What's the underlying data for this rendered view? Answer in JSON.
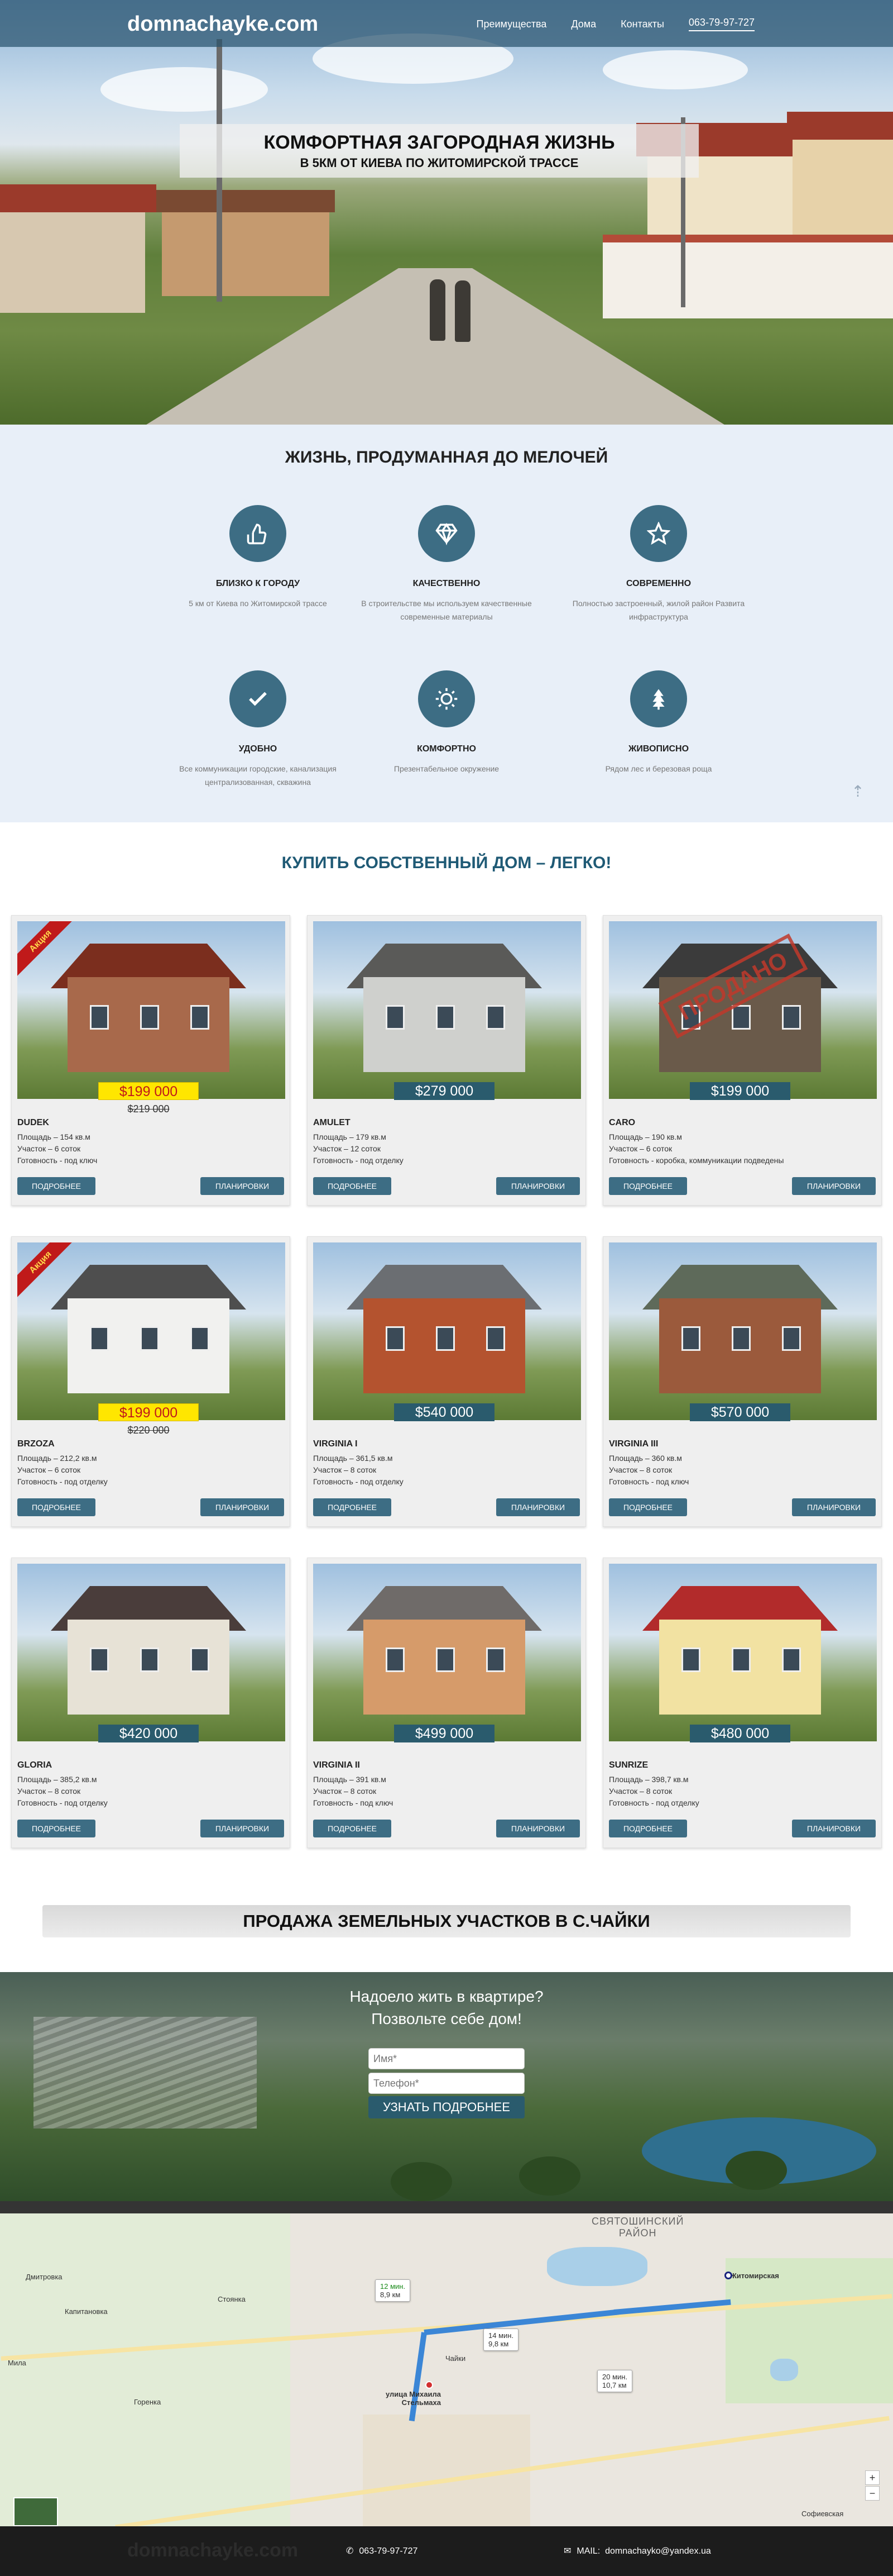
{
  "header": {
    "logo": "domnachayke.com",
    "nav": [
      "Преимущества",
      "Дома",
      "Контакты"
    ],
    "phone": "063-79-97-727"
  },
  "hero": {
    "title": "КОМФОРТНАЯ ЗАГОРОДНАЯ ЖИЗНЬ",
    "subtitle": "В 5КМ ОТ КИЕВА ПО ЖИТОМИРСКОЙ ТРАССЕ"
  },
  "features": {
    "title": "ЖИЗНЬ, ПРОДУМАННАЯ ДО МЕЛОЧЕЙ",
    "items": [
      {
        "icon": "thumbs-up-icon",
        "title": "БЛИЗКО К ГОРОДУ",
        "desc": "5 км от Киева по Житомирской трассе"
      },
      {
        "icon": "diamond-icon",
        "title": "КАЧЕСТВЕННО",
        "desc": "В строительстве мы используем качественные современные материалы"
      },
      {
        "icon": "star-icon",
        "title": "СОВРЕМЕННО",
        "desc": "Полностью застроенный, жилой район Развита инфраструктура"
      },
      {
        "icon": "check-icon",
        "title": "УДОБНО",
        "desc": "Все коммуникации городские, канализация централизованная, скважина"
      },
      {
        "icon": "sun-icon",
        "title": "КОМФОРТНО",
        "desc": "Презентабельное окружение"
      },
      {
        "icon": "tree-icon",
        "title": "ЖИВОПИСНО",
        "desc": "Рядом лес и березовая роща"
      }
    ]
  },
  "catalog": {
    "title": "КУПИТЬ СОБСТВЕННЫЙ ДОМ – ЛЕГКО!",
    "more_label": "ПОДРОБНЕЕ",
    "plans_label": "ПЛАНИРОВКИ",
    "sale_badge": "Акция",
    "sold_stamp": "ПРОДАНО",
    "houses": [
      {
        "name": "DUDEK",
        "price": "$199 000",
        "old_price": "$219 000",
        "area": "Площадь – 154 кв.м",
        "plot": "Участок – 6 соток",
        "ready": "Готовность - под ключ"
      },
      {
        "name": "AMULET",
        "price": "$279 000",
        "area": "Площадь – 179 кв.м",
        "plot": "Участок – 12 соток",
        "ready": "Готовность - под отделку"
      },
      {
        "name": "CARO",
        "price": "$199 000",
        "area": "Площадь – 190 кв.м",
        "plot": "Участок – 6 соток",
        "ready": "Готовность - коробка, коммуникации подведены"
      },
      {
        "name": "BRZOZA",
        "price": "$199 000",
        "old_price": "$220 000",
        "area": "Площадь – 212,2 кв.м",
        "plot": "Участок – 6 соток",
        "ready": "Готовность - под отделку"
      },
      {
        "name": "VIRGINIA I",
        "price": "$540 000",
        "area": "Площадь – 361,5 кв.м",
        "plot": "Участок – 8 соток",
        "ready": "Готовность - под отделку"
      },
      {
        "name": "VIRGINIA III",
        "price": "$570 000",
        "area": "Площадь – 360 кв.м",
        "plot": "Участок – 8 соток",
        "ready": "Готовность - под ключ"
      },
      {
        "name": "GLORIA",
        "price": "$420 000",
        "area": "Площадь – 385,2 кв.м",
        "plot": "Участок – 8 соток",
        "ready": "Готовность - под отделку"
      },
      {
        "name": "VIRGINIA II",
        "price": "$499 000",
        "area": "Площадь – 391 кв.м",
        "plot": "Участок – 8 соток",
        "ready": "Готовность - под ключ"
      },
      {
        "name": "SUNRIZE",
        "price": "$480 000",
        "area": "Площадь – 398,7 кв.м",
        "plot": "Участок – 8 соток",
        "ready": "Готовность - под отделку"
      }
    ]
  },
  "land": {
    "title": "ПРОДАЖА ЗЕМЕЛЬНЫХ УЧАСТКОВ В С.ЧАЙКИ"
  },
  "form": {
    "line1": "Надоело жить в квартире?",
    "line2": "Позвольте себе дом!",
    "name_placeholder": "Имя*",
    "phone_placeholder": "Телефон*",
    "submit": "УЗНАТЬ ПОДРОБНЕЕ"
  },
  "map": {
    "district": "СВЯТОШИНСКИЙ\nРАЙОН",
    "destination": "Житомирская",
    "origin": "улица Михаила Стельмаха",
    "routes": [
      {
        "time": "12 мин.",
        "dist": "8,9 км"
      },
      {
        "time": "14 мин.",
        "dist": "9,8 км"
      },
      {
        "time": "20 мин.",
        "dist": "10,7 км"
      }
    ],
    "places": [
      "Дмитровка",
      "Капитановка",
      "Стоянка",
      "Чайки",
      "Мила",
      "Горенка",
      "Софиевская"
    ],
    "zoom_in": "+",
    "zoom_out": "−"
  },
  "footer": {
    "logo": "domnachayke.com",
    "phone": "063-79-97-727",
    "mail_label": "MAIL",
    "mail": "domnachayko@yandex.ua"
  }
}
